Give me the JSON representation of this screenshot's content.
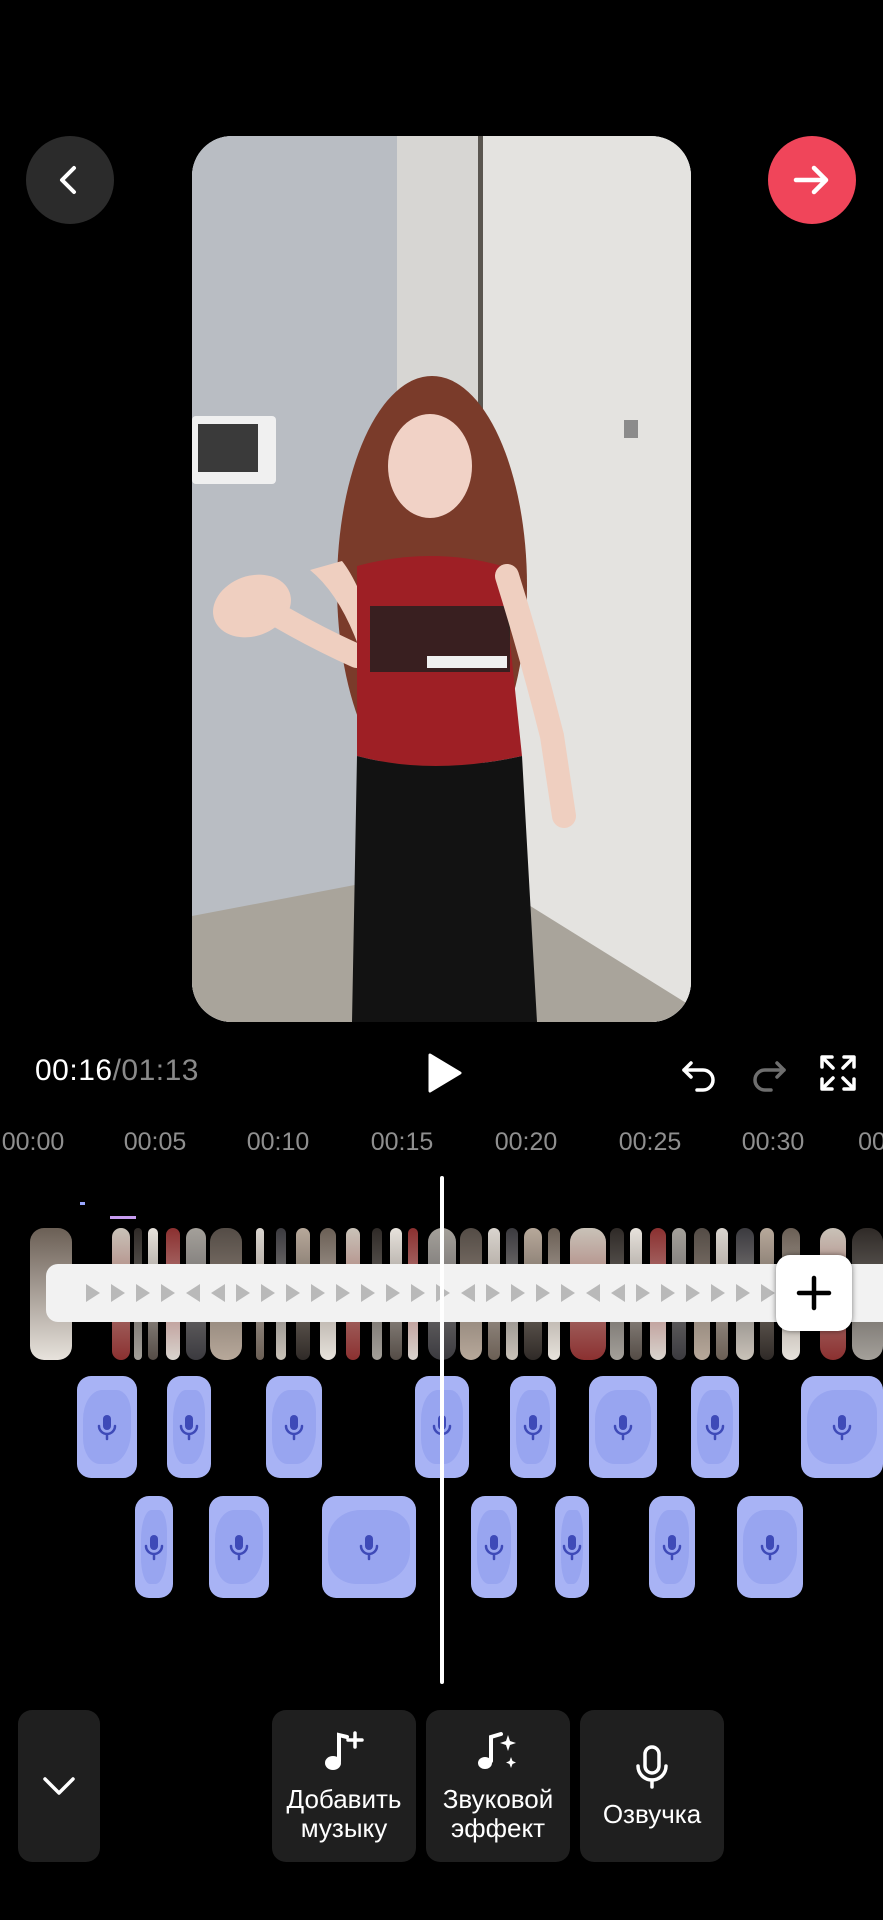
{
  "player": {
    "current_time": "00:16",
    "separator": "/",
    "total_time": "01:13"
  },
  "ruler": {
    "ticks": [
      "00:00",
      "00:05",
      "00:10",
      "00:15",
      "00:20",
      "00:25",
      "00:30",
      "00"
    ]
  },
  "toolbar": {
    "add_music_label": "Добавить\nмузыку",
    "sound_effect_label": "Звуковой\nэффект",
    "voiceover_label": "Озвучка"
  },
  "icons": {
    "back": "chevron-left-icon",
    "next": "arrow-right-icon",
    "play": "play-icon",
    "undo": "undo-icon",
    "redo": "redo-icon",
    "fullscreen": "fullscreen-icon",
    "add_clip": "plus-icon",
    "collapse": "chevron-down-icon",
    "music": "music-note-plus-icon",
    "effect": "music-sparkle-icon",
    "mic": "microphone-icon"
  },
  "colors": {
    "accent": "#f0455a",
    "voiceover_clip": "#a8b3f5",
    "mic": "#3e4ab8"
  }
}
